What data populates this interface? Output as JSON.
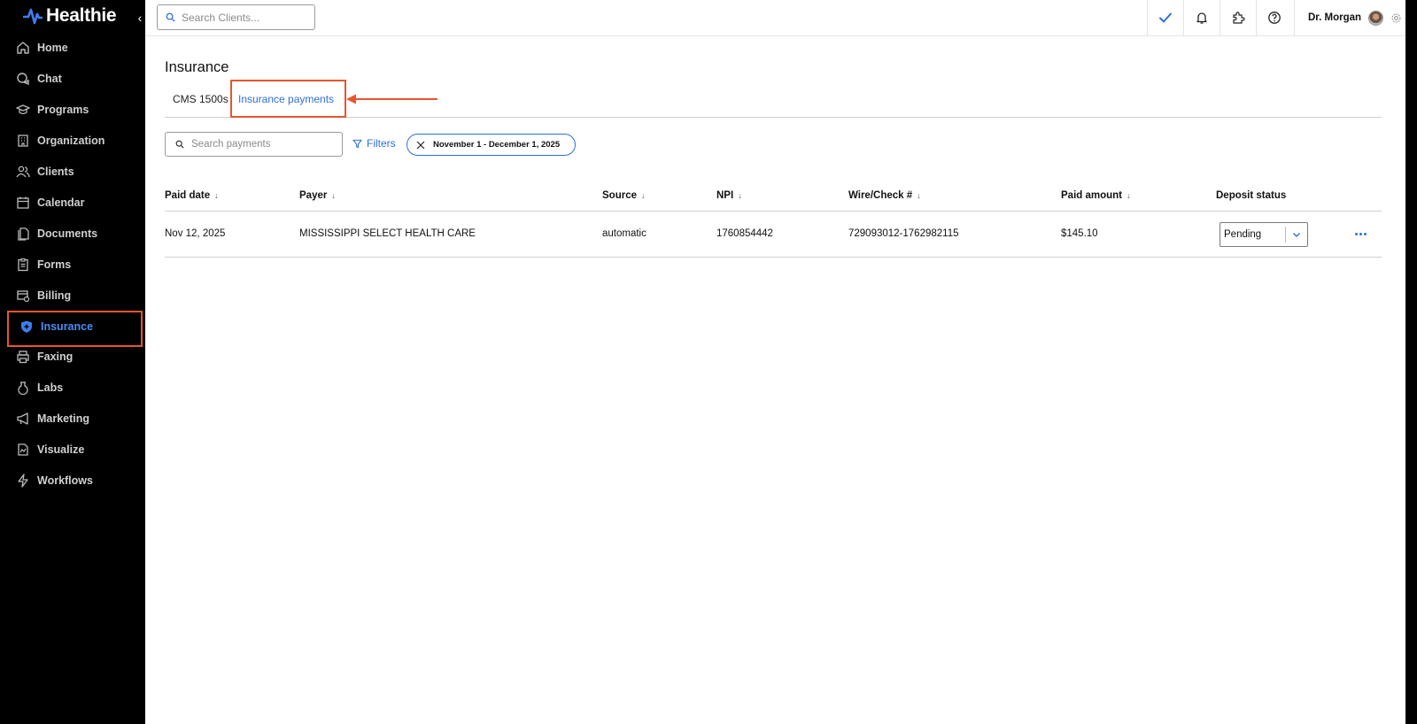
{
  "brand": {
    "name": "Healthie",
    "accent": "#2f6fd6",
    "highlight": "#e8552e"
  },
  "sidebar": {
    "items": [
      {
        "label": "Home",
        "icon": "home-icon"
      },
      {
        "label": "Chat",
        "icon": "chat-icon"
      },
      {
        "label": "Programs",
        "icon": "graduation-cap-icon"
      },
      {
        "label": "Organization",
        "icon": "building-icon"
      },
      {
        "label": "Clients",
        "icon": "users-icon"
      },
      {
        "label": "Calendar",
        "icon": "calendar-icon"
      },
      {
        "label": "Documents",
        "icon": "documents-icon"
      },
      {
        "label": "Forms",
        "icon": "clipboard-icon"
      },
      {
        "label": "Billing",
        "icon": "billing-icon"
      },
      {
        "label": "Insurance",
        "icon": "shield-icon",
        "active": true
      },
      {
        "label": "Faxing",
        "icon": "printer-icon"
      },
      {
        "label": "Labs",
        "icon": "flask-icon"
      },
      {
        "label": "Marketing",
        "icon": "megaphone-icon"
      },
      {
        "label": "Visualize",
        "icon": "chart-file-icon"
      },
      {
        "label": "Workflows",
        "icon": "lightning-icon"
      }
    ]
  },
  "topbar": {
    "search_placeholder": "Search Clients...",
    "user_name": "Dr. Morgan"
  },
  "page": {
    "title": "Insurance",
    "tabs": [
      {
        "label": "CMS 1500s"
      },
      {
        "label": "Insurance payments",
        "active": true
      }
    ],
    "search_placeholder": "Search payments",
    "filters_label": "Filters",
    "date_chip": "November 1 - December 1, 2025"
  },
  "table": {
    "columns": [
      "Paid date",
      "Payer",
      "Source",
      "NPI",
      "Wire/Check #",
      "Paid amount",
      "Deposit status"
    ],
    "rows": [
      {
        "paid_date": "Nov 12, 2025",
        "payer": "MISSISSIPPI SELECT HEALTH CARE",
        "source": "automatic",
        "npi": "1760854442",
        "wire_check": "729093012-1762982115",
        "paid_amount": "$145.10",
        "deposit_status": "Pending"
      }
    ]
  }
}
